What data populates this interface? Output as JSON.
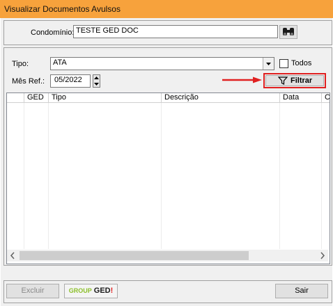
{
  "window": {
    "title": "Visualizar Documentos Avulsos"
  },
  "condominio": {
    "label": "Condomínio:",
    "value": "TESTE GED DOC"
  },
  "filter": {
    "tipo_label": "Tipo:",
    "tipo_value": "ATA",
    "todos_label": "Todos",
    "todos_checked": false,
    "mes_label": "Mês Ref.:",
    "mes_value": "05/2022",
    "filtrar_label": "Filtrar"
  },
  "table": {
    "columns": [
      "GED",
      "Tipo",
      "Descrição",
      "Data",
      "C"
    ],
    "rows": []
  },
  "footer": {
    "excluir_label": "Excluir",
    "group_label": "GROUP",
    "ged_label": "GED",
    "sair_label": "Sair"
  },
  "colors": {
    "titlebar": "#f7a23c",
    "highlight": "#e02020"
  },
  "icons": [
    "binoculars-icon",
    "dropdown-arrow-icon",
    "spin-up-icon",
    "spin-down-icon",
    "funnel-icon",
    "red-arrow-icon",
    "scroll-left-icon",
    "scroll-right-icon"
  ]
}
